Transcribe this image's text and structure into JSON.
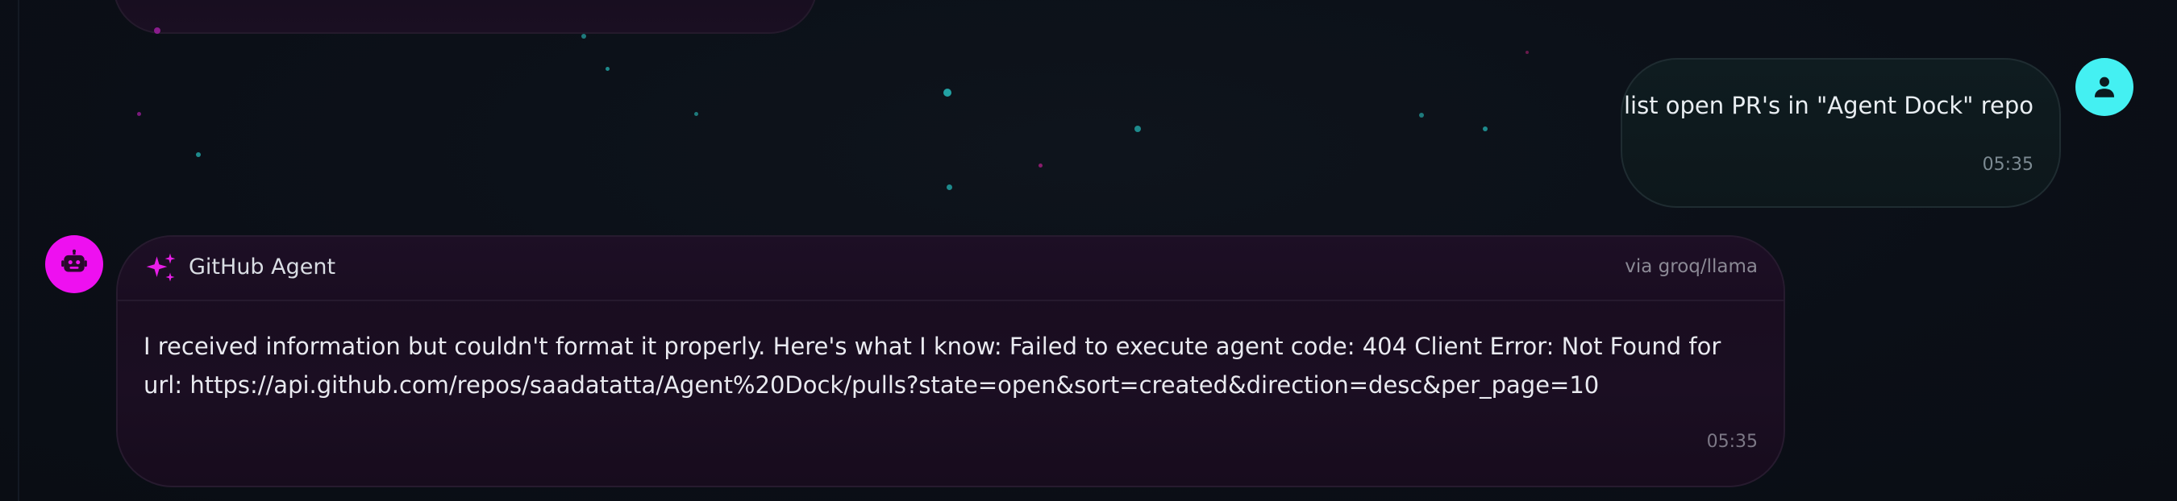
{
  "messages": {
    "user": {
      "text": "list open PR's in \"Agent Dock\" repo",
      "time": "05:35",
      "avatar_icon": "user-icon",
      "avatar_color": "#44f0f2"
    },
    "agent": {
      "name": "GitHub Agent",
      "via": "via groq/llama",
      "text": "I received information but couldn't format it properly. Here's what I know: Failed to execute agent code: 404 Client Error: Not Found for url: https://api.github.com/repos/saadatatta/Agent%20Dock/pulls?state=open&sort=created&direction=desc&per_page=10",
      "time": "05:35",
      "avatar_icon": "robot-icon",
      "avatar_color": "#ee10f0",
      "header_icon": "sparkles-icon"
    }
  }
}
